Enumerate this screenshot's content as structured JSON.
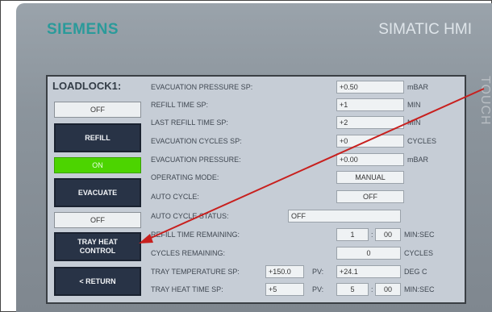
{
  "bezel": {
    "brand": "SIEMENS",
    "model": "SIMATIC HMI",
    "side_text": "TOUCH"
  },
  "screen": {
    "title": "LOADLOCK1:",
    "buttons": {
      "refill_state": "OFF",
      "refill": "REFILL",
      "evacuate_state": "ON",
      "evacuate": "EVACUATE",
      "tray_state": "OFF",
      "tray_heat_line1": "TRAY HEAT",
      "tray_heat_line2": "CONTROL",
      "return": "< RETURN"
    },
    "fields": {
      "evac_pressure_sp": {
        "label": "EVACUATION PRESSURE SP:",
        "value": "+0.50",
        "unit": "mBAR"
      },
      "refill_time_sp": {
        "label": "REFILL TIME SP:",
        "value": "+1",
        "unit": "MIN"
      },
      "last_refill_time_sp": {
        "label": "LAST REFILL TIME SP:",
        "value": "+2",
        "unit": "MIN"
      },
      "evac_cycles_sp": {
        "label": "EVACUATION CYCLES SP:",
        "value": "+0",
        "unit": "CYCLES"
      },
      "evac_pressure": {
        "label": "EVACUATION PRESSURE:",
        "value": "+0.00",
        "unit": "mBAR"
      },
      "operating_mode": {
        "label": "OPERATING MODE:",
        "value": "MANUAL"
      },
      "auto_cycle": {
        "label": "AUTO CYCLE:",
        "value": "OFF"
      },
      "auto_cycle_status": {
        "label": "AUTO CYCLE STATUS:",
        "value": "OFF"
      },
      "refill_time_remaining": {
        "label": "REFILL TIME REMAINING:",
        "min": "1",
        "sec": "00",
        "unit": "MIN:SEC"
      },
      "cycles_remaining": {
        "label": "CYCLES REMAINING:",
        "value": "0",
        "unit": "CYCLES"
      },
      "tray_temp_sp": {
        "label": "TRAY TEMPERATURE SP:",
        "value": "+150.0",
        "pv_label": "PV:",
        "pv": "+24.1",
        "unit": "DEG C"
      },
      "tray_heat_time_sp": {
        "label": "TRAY HEAT TIME SP:",
        "value": "+5",
        "pv_label": "PV:",
        "min": "5",
        "sec": "00",
        "unit": "MIN:SEC"
      }
    }
  },
  "colors": {
    "on_green": "#4cd400",
    "button_navy": "#283346",
    "screen_bg": "#c6cdd6",
    "brand_teal": "#2a9a9a",
    "arrow_red": "#c8201e"
  }
}
